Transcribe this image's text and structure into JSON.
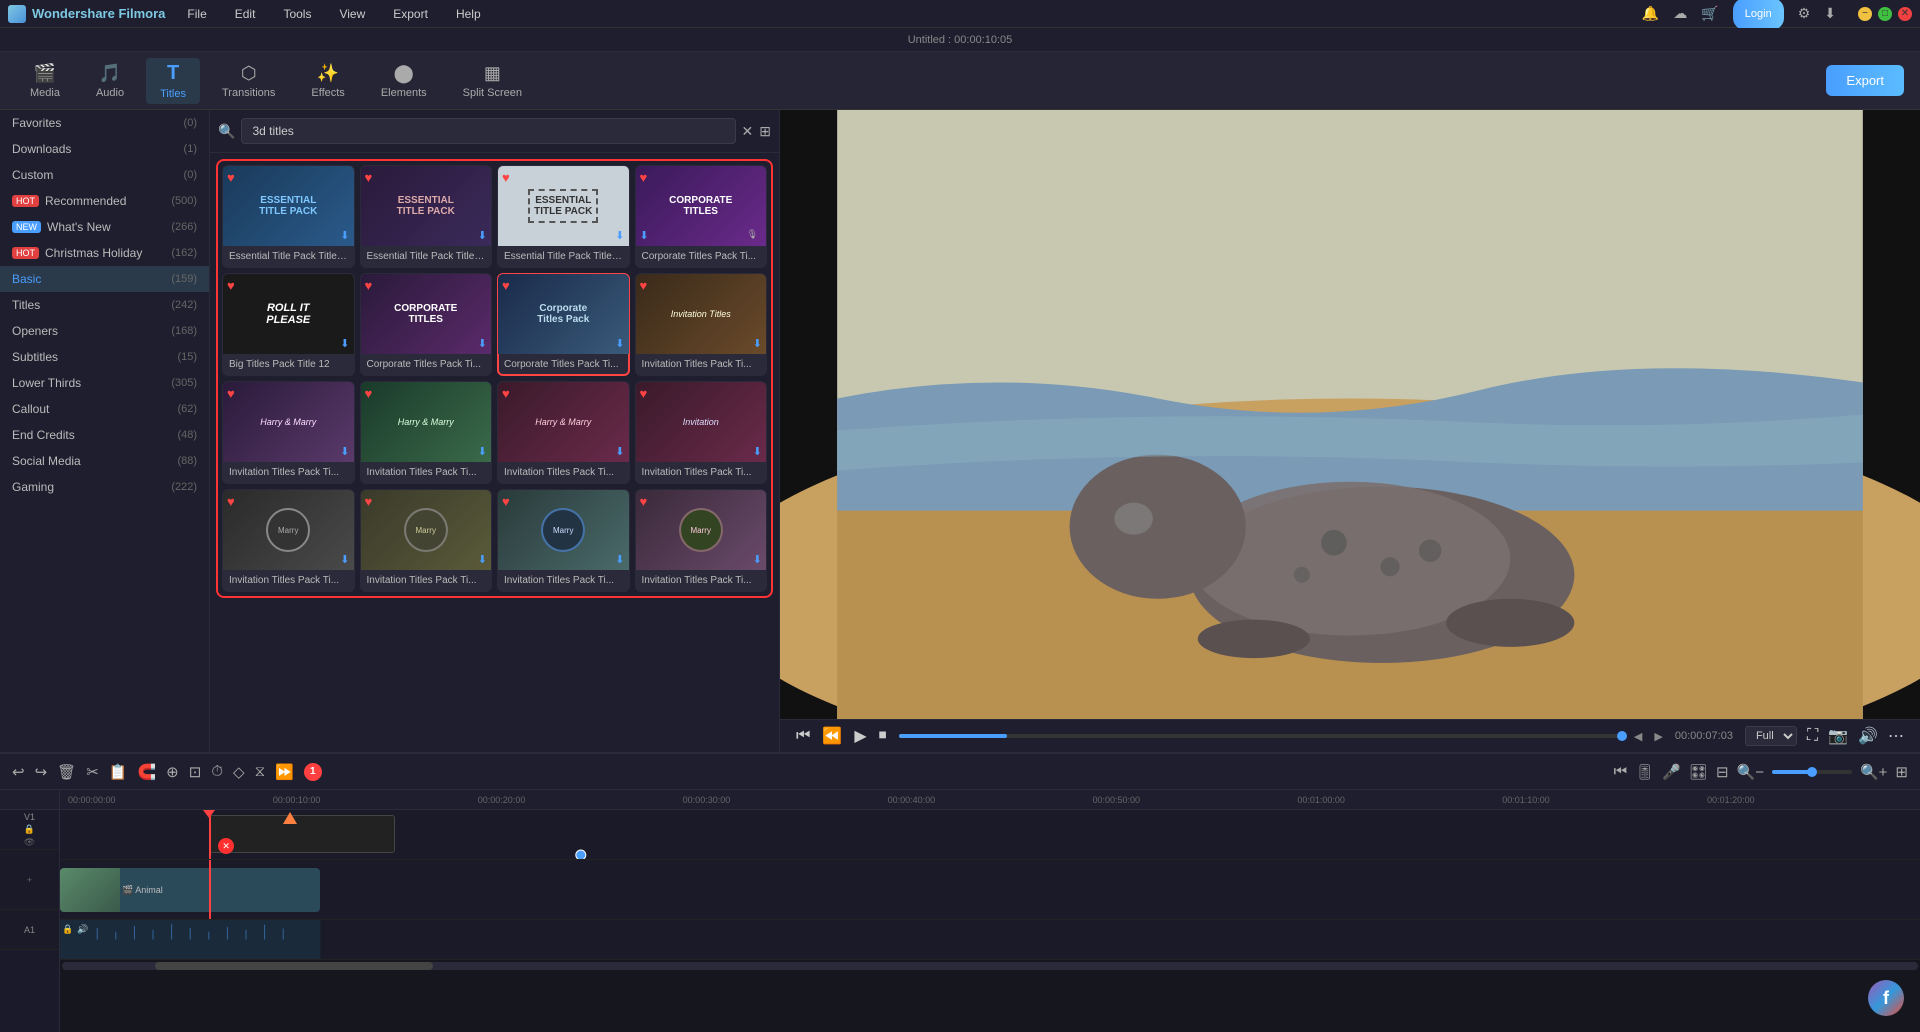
{
  "app": {
    "name": "Wondershare Filmora",
    "project_title": "Untitled : 00:00:10:05"
  },
  "menu": {
    "items": [
      "File",
      "Edit",
      "Tools",
      "View",
      "Export",
      "Help"
    ]
  },
  "toolbar": {
    "export_label": "Export",
    "tabs": [
      {
        "id": "media",
        "label": "Media",
        "icon": "🎬"
      },
      {
        "id": "audio",
        "label": "Audio",
        "icon": "🎵"
      },
      {
        "id": "titles",
        "label": "Titles",
        "icon": "T",
        "active": true
      },
      {
        "id": "transitions",
        "label": "Transitions",
        "icon": "⬡"
      },
      {
        "id": "effects",
        "label": "Effects",
        "icon": "✨"
      },
      {
        "id": "elements",
        "label": "Elements",
        "icon": "⬤"
      },
      {
        "id": "split_screen",
        "label": "Split Screen",
        "icon": "▦"
      }
    ]
  },
  "sidebar": {
    "items": [
      {
        "id": "favorites",
        "label": "Favorites",
        "count": "(0)"
      },
      {
        "id": "downloads",
        "label": "Downloads",
        "count": "(1)",
        "active": false
      },
      {
        "id": "custom",
        "label": "Custom",
        "count": "(0)",
        "active": false
      },
      {
        "id": "recommended",
        "label": "Recommended",
        "count": "(500)",
        "hot": true
      },
      {
        "id": "whats_new",
        "label": "What's New",
        "count": "(266)",
        "new": true
      },
      {
        "id": "christmas_holiday",
        "label": "Christmas Holiday",
        "count": "(162)",
        "hot": true
      },
      {
        "id": "basic",
        "label": "Basic",
        "count": "(159)",
        "active": true
      },
      {
        "id": "titles",
        "label": "Titles",
        "count": "(242)"
      },
      {
        "id": "openers",
        "label": "Openers",
        "count": "(168)"
      },
      {
        "id": "subtitles",
        "label": "Subtitles",
        "count": "(15)"
      },
      {
        "id": "lower_thirds",
        "label": "Lower Thirds",
        "count": "(305)"
      },
      {
        "id": "callout",
        "label": "Callout",
        "count": "(62)"
      },
      {
        "id": "end_credits",
        "label": "End Credits",
        "count": "(48)"
      },
      {
        "id": "social_media",
        "label": "Social Media",
        "count": "(88)"
      },
      {
        "id": "gaming",
        "label": "Gaming",
        "count": "(222)"
      }
    ]
  },
  "search": {
    "placeholder": "3d titles",
    "value": "3d titles"
  },
  "grid": {
    "cards": [
      {
        "id": "c1",
        "label": "Essential Title Pack Title ...",
        "thumb_class": "thumb-essential1",
        "heart": true
      },
      {
        "id": "c2",
        "label": "Essential Title Pack Title ...",
        "thumb_class": "thumb-essential2",
        "heart": true
      },
      {
        "id": "c3",
        "label": "Essential Title Pack Title ...",
        "thumb_class": "thumb-essential3",
        "heart": true
      },
      {
        "id": "c4",
        "label": "Corporate Titles Pack Ti...",
        "thumb_class": "thumb-corporate1",
        "heart": true
      },
      {
        "id": "c5",
        "label": "Big Titles Pack Title 12",
        "thumb_class": "thumb-big-titles",
        "heart": true
      },
      {
        "id": "c6",
        "label": "Corporate Titles Pack Ti...",
        "thumb_class": "thumb-corporate2",
        "heart": true
      },
      {
        "id": "c7",
        "label": "Corporate Titles Pack Ti...",
        "thumb_class": "thumb-corporate3",
        "heart": true,
        "selected": true
      },
      {
        "id": "c8",
        "label": "Invitation Titles Pack Ti...",
        "thumb_class": "thumb-invitation1",
        "heart": true
      },
      {
        "id": "c9",
        "label": "Invitation Titles Pack Ti...",
        "thumb_class": "thumb-invitation2",
        "heart": true
      },
      {
        "id": "c10",
        "label": "Invitation Titles Pack Ti...",
        "thumb_class": "thumb-invitation3",
        "heart": true
      },
      {
        "id": "c11",
        "label": "Invitation Titles Pack Ti...",
        "thumb_class": "thumb-invitation4",
        "heart": true
      },
      {
        "id": "c12",
        "label": "Invitation Titles Pack Ti...",
        "thumb_class": "thumb-invitation4",
        "heart": true
      },
      {
        "id": "c13",
        "label": "Invitation Titles Pack Ti...",
        "thumb_class": "thumb-circle1",
        "heart": true
      },
      {
        "id": "c14",
        "label": "Invitation Titles Pack Ti...",
        "thumb_class": "thumb-circle2",
        "heart": true
      },
      {
        "id": "c15",
        "label": "Invitation Titles Pack Ti...",
        "thumb_class": "thumb-circle3",
        "heart": true
      },
      {
        "id": "c16",
        "label": "Invitation Titles Pack Ti...",
        "thumb_class": "thumb-circle4",
        "heart": true
      }
    ]
  },
  "playback": {
    "time": "00:00:07:03",
    "progress_pct": 15,
    "quality": "Full"
  },
  "timeline": {
    "markers": [
      "00:00:00:00",
      "00:00:10:00",
      "00:00:20:00",
      "00:00:30:00",
      "00:00:40:00",
      "00:00:50:00",
      "00:01:00:00",
      "00:01:10:00",
      "00:01:20:00"
    ],
    "track1_label": "V1",
    "track2_label": "A1",
    "clip_label": "Animal"
  }
}
